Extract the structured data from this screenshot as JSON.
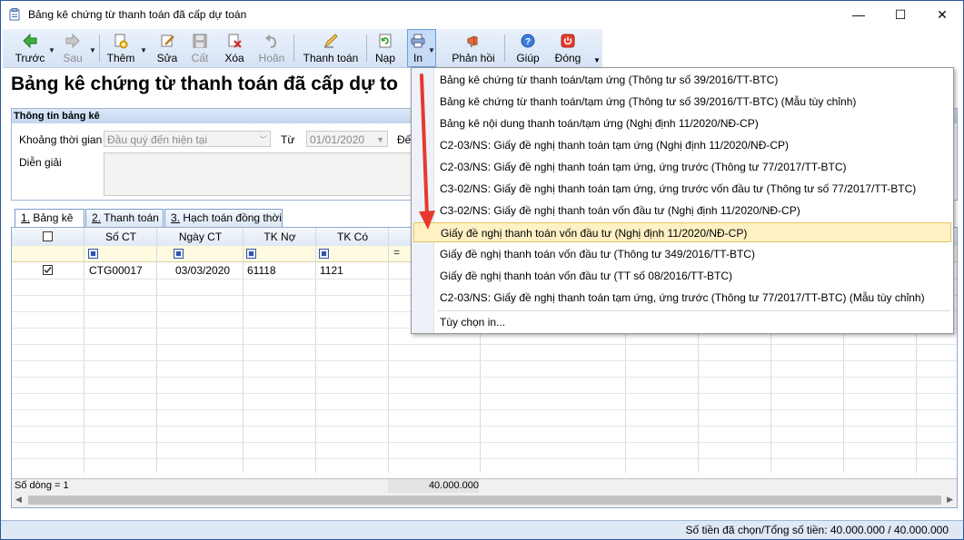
{
  "window": {
    "title": "Bảng kê chứng từ thanh toán đã cấp dự toán",
    "minimize_glyph": "—",
    "maximize_glyph": "☐",
    "close_glyph": "✕"
  },
  "toolbar": {
    "items": [
      {
        "label": "Trước",
        "icon": "arrow-left-icon",
        "enabled": true
      },
      {
        "label": "Sau",
        "icon": "arrow-right-icon",
        "enabled": false
      },
      {
        "label": "Thêm",
        "icon": "add-document-icon",
        "enabled": true
      },
      {
        "label": "Sửa",
        "icon": "edit-icon",
        "enabled": true
      },
      {
        "label": "Cất",
        "icon": "save-icon",
        "enabled": false
      },
      {
        "label": "Xóa",
        "icon": "delete-icon",
        "enabled": true
      },
      {
        "label": "Hoãn",
        "icon": "undo-icon",
        "enabled": false
      },
      {
        "label": "Thanh toán",
        "icon": "pen-icon",
        "enabled": true
      },
      {
        "label": "Nạp",
        "icon": "refresh-icon",
        "enabled": true
      },
      {
        "label": "In",
        "icon": "printer-icon",
        "enabled": true
      },
      {
        "label": "Phản hồi",
        "icon": "megaphone-icon",
        "enabled": true
      },
      {
        "label": "Giúp",
        "icon": "help-icon",
        "enabled": true
      },
      {
        "label": "Đóng",
        "icon": "power-icon",
        "enabled": true
      }
    ]
  },
  "page_title": "Bảng kê chứng từ thanh toán đã cấp dự to",
  "info": {
    "header": "Thông tin bảng kê",
    "period_label": "Khoảng thời gian",
    "period_value": "Đầu quý đến hiện tại",
    "from_label": "Từ",
    "from_value": "01/01/2020",
    "to_label_partial": "Đế",
    "description_label": "Diễn giải"
  },
  "tabs": [
    {
      "number": "1.",
      "label": "Bảng kê",
      "active": true
    },
    {
      "number": "2.",
      "label": "Thanh toán",
      "active": false
    },
    {
      "number": "3.",
      "label": "Hạch toán đồng thời",
      "active": false
    }
  ],
  "grid": {
    "columns": [
      "Số CT",
      "Ngày CT",
      "TK Nợ",
      "TK Có"
    ],
    "rows": [
      {
        "checked": true,
        "so_ct": "CTG00017",
        "ngay_ct": "03/03/2020",
        "tk_no": "61118",
        "tk_co": "1121"
      }
    ],
    "footer_count": "Số dòng = 1",
    "footer_total": "40.000.000",
    "filter_eq": "="
  },
  "status": {
    "text": "Số tiền đã chọn/Tổng số tiền: 40.000.000 / 40.000.000"
  },
  "print_menu": {
    "items": [
      "Bảng kê chứng từ thanh toán/tạm ứng (Thông tư số 39/2016/TT-BTC)",
      "Bảng kê chứng từ thanh toán/tạm ứng (Thông tư số 39/2016/TT-BTC) (Mẫu tùy chỉnh)",
      "Bảng kê nội dung thanh toán/tạm ứng (Nghị định 11/2020/NĐ-CP)",
      "C2-03/NS: Giấy đề nghị thanh toán tạm ứng (Nghị định 11/2020/NĐ-CP)",
      "C2-03/NS: Giấy đề nghị thanh toán tạm ứng, ứng trước (Thông tư 77/2017/TT-BTC)",
      "C3-02/NS: Giấy đề nghị thanh toán tạm ứng, ứng trước vốn đầu tư (Thông tư số 77/2017/TT-BTC)",
      "C3-02/NS: Giấy đề nghị thanh toán vốn đầu tư (Nghị định 11/2020/NĐ-CP)",
      "Giấy đề nghị thanh toán vốn đầu tư (Nghị định 11/2020/NĐ-CP)",
      "Giấy đề nghị thanh toán vốn đầu tư (Thông tư 349/2016/TT-BTC)",
      "Giấy đề nghị thanh toán vốn đầu tư (TT số 08/2016/TT-BTC)",
      "C2-03/NS: Giấy đề nghị thanh toán tạm ứng, ứng trước (Thông tư 77/2017/TT-BTC) (Mẫu tùy chỉnh)"
    ],
    "highlighted_index": 7,
    "options_item": "Tùy chọn in..."
  },
  "colors": {
    "accent": "#2b579a",
    "highlight": "#fff1c4",
    "arrow": "#e8392f"
  }
}
